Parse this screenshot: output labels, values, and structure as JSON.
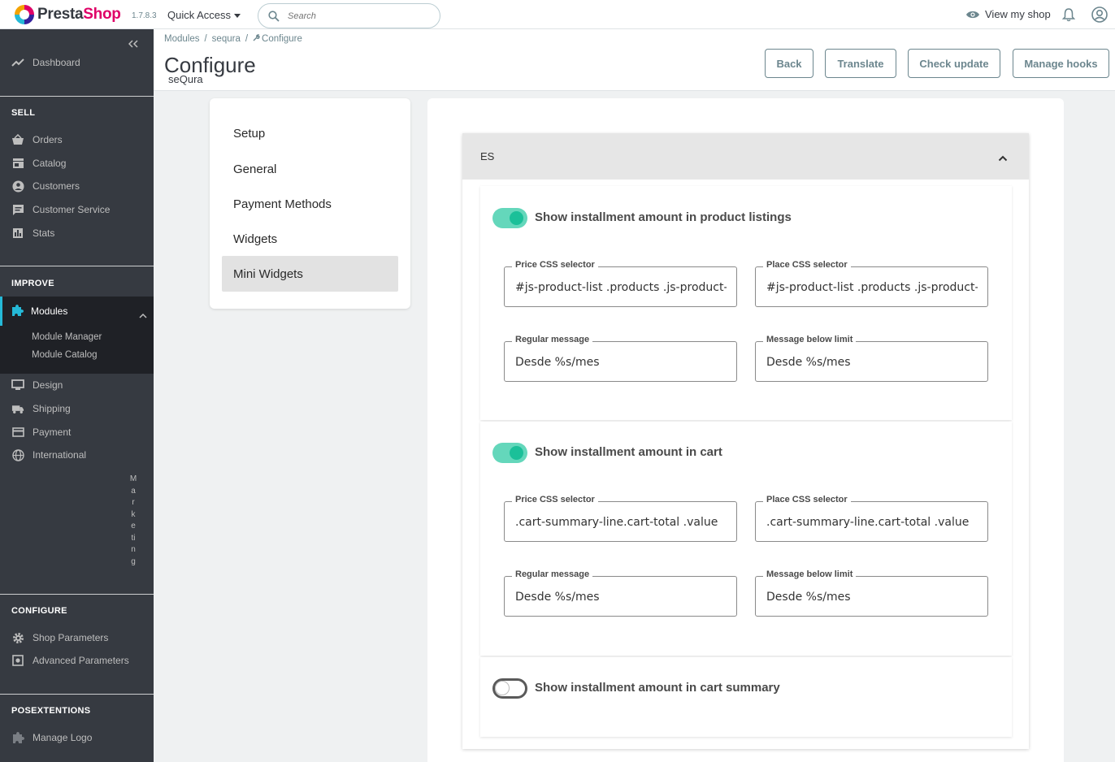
{
  "header": {
    "logo_text_presta": "Presta",
    "logo_text_shop": "Shop",
    "version": "1.7.8.3",
    "quick_access": "Quick Access",
    "search_placeholder": "Search",
    "view_shop": "View my shop"
  },
  "sidebar": {
    "dashboard": "Dashboard",
    "sell_title": "SELL",
    "orders": "Orders",
    "catalog": "Catalog",
    "customers": "Customers",
    "customer_service": "Customer Service",
    "stats": "Stats",
    "improve_title": "IMPROVE",
    "modules": "Modules",
    "module_manager": "Module Manager",
    "module_catalog": "Module Catalog",
    "design": "Design",
    "shipping": "Shipping",
    "payment": "Payment",
    "international": "International",
    "marketing_letters": [
      "M",
      "a",
      "r",
      "k",
      "e",
      "ti",
      "n",
      "g"
    ],
    "configure_title": "CONFIGURE",
    "shop_parameters": "Shop Parameters",
    "advanced_parameters": "Advanced Parameters",
    "posextentions_title": "POSEXTENTIONS",
    "manage_logo": "Manage Logo"
  },
  "page": {
    "breadcrumb": [
      "Modules",
      "sequra",
      "Configure"
    ],
    "title": "Configure",
    "subtitle": "seQura",
    "buttons": {
      "back": "Back",
      "translate": "Translate",
      "check_update": "Check update",
      "manage_hooks": "Manage hooks"
    }
  },
  "menu": {
    "items": [
      "Setup",
      "General",
      "Payment Methods",
      "Widgets",
      "Mini Widgets"
    ],
    "active": "Mini Widgets"
  },
  "accordion": {
    "label": "ES",
    "expanded": true,
    "sections": [
      {
        "toggle_label": "Show installment amount in product listings",
        "enabled": true,
        "price_css_label": "Price CSS selector",
        "price_css_value": "#js-product-list .products .js-product-miniature .price",
        "place_css_label": "Place CSS selector",
        "place_css_value": "#js-product-list .products .js-product-miniature .product-price-and-shipping",
        "regular_label": "Regular message",
        "regular_value": "Desde %s/mes",
        "below_label": "Message below limit",
        "below_value": "Desde %s/mes"
      },
      {
        "toggle_label": "Show installment amount in cart",
        "enabled": true,
        "price_css_label": "Price CSS selector",
        "price_css_value": ".cart-summary-line.cart-total .value",
        "place_css_label": "Place CSS selector",
        "place_css_value": ".cart-summary-line.cart-total .value",
        "regular_label": "Regular message",
        "regular_value": "Desde %s/mes",
        "below_label": "Message below limit",
        "below_value": "Desde %s/mes"
      },
      {
        "toggle_label": "Show installment amount in cart summary",
        "enabled": false
      }
    ]
  },
  "colors": {
    "sidebar_bg": "#363a41",
    "accent": "#25b9d7",
    "toggle_on": "#1bc099",
    "brand_pink": "#df0067"
  }
}
